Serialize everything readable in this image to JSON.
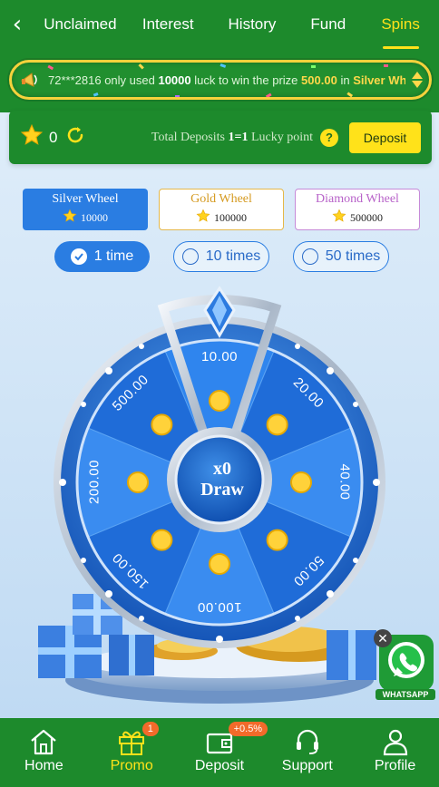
{
  "topbar": {
    "back_icon": "chevron-left-icon",
    "tabs": [
      {
        "label": "Unclaimed",
        "active": false
      },
      {
        "label": "Interest",
        "active": false
      },
      {
        "label": "History",
        "active": false
      },
      {
        "label": "Fund",
        "active": false
      },
      {
        "label": "Spins",
        "active": true
      }
    ]
  },
  "marquee": {
    "user": "72***2816",
    "text1": "only used",
    "luck": "10000",
    "text2": "luck to win the prize",
    "prize": "500.00",
    "text3": "in",
    "wheel": "Silver Wh"
  },
  "deposit_row": {
    "star_count": "0",
    "total_label": "Total Deposits",
    "ratio": "1=1",
    "lucky_label": "Lucky point",
    "help": "?",
    "deposit_button": "Deposit"
  },
  "wheels": [
    {
      "name": "Silver Wheel",
      "points": "10000",
      "selected": true
    },
    {
      "name": "Gold Wheel",
      "points": "100000",
      "selected": false
    },
    {
      "name": "Diamond Wheel",
      "points": "500000",
      "selected": false
    }
  ],
  "times": [
    {
      "label": "1 time",
      "selected": true
    },
    {
      "label": "10 times",
      "selected": false
    },
    {
      "label": "50 times",
      "selected": false
    }
  ],
  "wheel": {
    "prizes": [
      "10.00",
      "20.00",
      "40.00",
      "50.00",
      "100.00",
      "150.00",
      "200.00",
      "500.00"
    ],
    "multiplier": "x0",
    "draw_label": "Draw"
  },
  "whatsapp": {
    "label": "WHATSAPP"
  },
  "bottom_nav": [
    {
      "label": "Home",
      "icon": "home-icon",
      "active": false,
      "badge": ""
    },
    {
      "label": "Promo",
      "icon": "gift-icon",
      "active": true,
      "badge": "1"
    },
    {
      "label": "Deposit",
      "icon": "wallet-icon",
      "active": false,
      "badge": "+0.5%"
    },
    {
      "label": "Support",
      "icon": "headset-icon",
      "active": false,
      "badge": ""
    },
    {
      "label": "Profile",
      "icon": "user-icon",
      "active": false,
      "badge": ""
    }
  ],
  "colors": {
    "brand_green": "#1d8a2c",
    "accent_yellow": "#ffe21a",
    "blue": "#2a7de2"
  }
}
